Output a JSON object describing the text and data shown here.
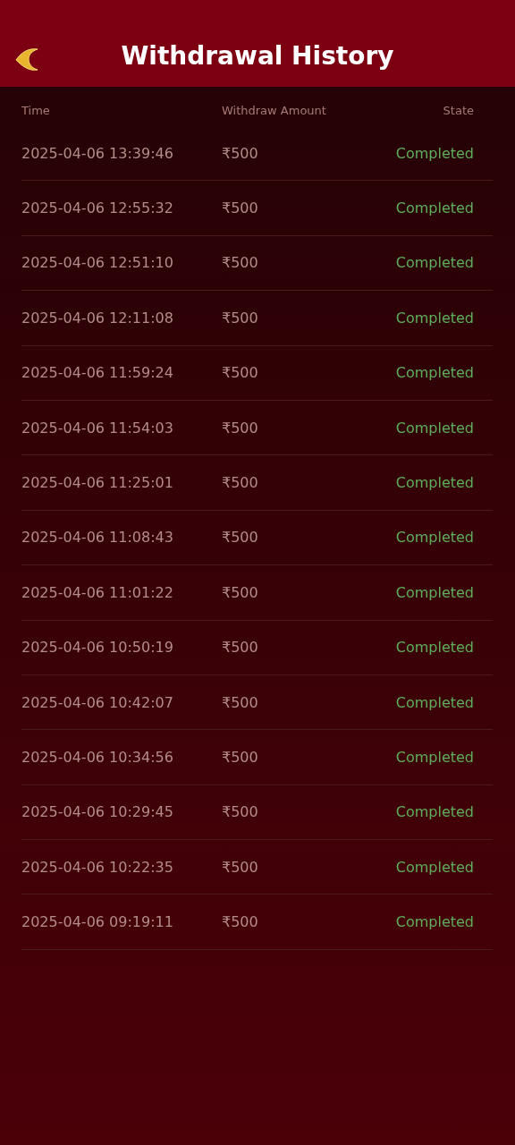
{
  "header": {
    "title": "Withdrawal History"
  },
  "table": {
    "columns": [
      "Time",
      "Withdraw Amount",
      "State"
    ],
    "rows": [
      {
        "time": "2025-04-06 13:39:46",
        "amount": "₹500",
        "state": "Completed"
      },
      {
        "time": "2025-04-06 12:55:32",
        "amount": "₹500",
        "state": "Completed"
      },
      {
        "time": "2025-04-06 12:51:10",
        "amount": "₹500",
        "state": "Completed"
      },
      {
        "time": "2025-04-06 12:11:08",
        "amount": "₹500",
        "state": "Completed"
      },
      {
        "time": "2025-04-06 11:59:24",
        "amount": "₹500",
        "state": "Completed"
      },
      {
        "time": "2025-04-06 11:54:03",
        "amount": "₹500",
        "state": "Completed"
      },
      {
        "time": "2025-04-06 11:25:01",
        "amount": "₹500",
        "state": "Completed"
      },
      {
        "time": "2025-04-06 11:08:43",
        "amount": "₹500",
        "state": "Completed"
      },
      {
        "time": "2025-04-06 11:01:22",
        "amount": "₹500",
        "state": "Completed"
      },
      {
        "time": "2025-04-06 10:50:19",
        "amount": "₹500",
        "state": "Completed"
      },
      {
        "time": "2025-04-06 10:42:07",
        "amount": "₹500",
        "state": "Completed"
      },
      {
        "time": "2025-04-06 10:34:56",
        "amount": "₹500",
        "state": "Completed"
      },
      {
        "time": "2025-04-06 10:29:45",
        "amount": "₹500",
        "state": "Completed"
      },
      {
        "time": "2025-04-06 10:22:35",
        "amount": "₹500",
        "state": "Completed"
      },
      {
        "time": "2025-04-06 09:19:11",
        "amount": "₹500",
        "state": "Completed"
      }
    ]
  }
}
